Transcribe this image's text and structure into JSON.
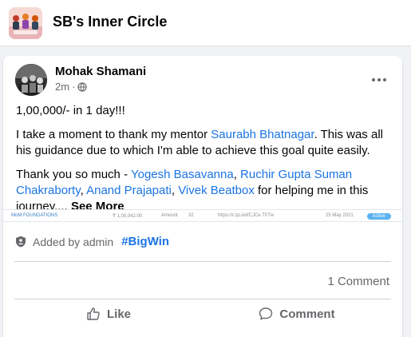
{
  "group": {
    "name": "SB's Inner Circle"
  },
  "post": {
    "author": "Mohak Shamani",
    "time": "2m",
    "separator": "·",
    "audience_icon": "globe-icon",
    "line1": "1,00,000/- in 1 day!!!",
    "line2_before": "I take a moment to thank my mentor ",
    "line2_mention": "Saurabh Bhatnagar",
    "line2_after": ". This was all his guidance due to which I'm able to achieve this goal quite easily.",
    "thanks_before": "Thank you so much - ",
    "mentions": [
      "Yogesh Basavanna",
      "Ruchir Gupta",
      "Suman Chakraborty",
      "Anand Prajapati",
      "Vivek Beatbox"
    ],
    "sep_comma": ", ",
    "sep_space": " ",
    "thanks_after": " for helping me in this journey....",
    "see_more": "See More"
  },
  "preview": {
    "org": "MoM FOUNDATIONS",
    "amount": "₹ 1,00,042.00",
    "amount_label": "Amount",
    "qty": "32",
    "link": "https://r.zp.io/l/CJCe T0Tw",
    "date": "25 May 2021",
    "status": "Active"
  },
  "added_by": {
    "icon": "admin-shield-icon",
    "text": "Added by admin",
    "hashtag": "#BigWin"
  },
  "comments": {
    "count_label": "1 Comment"
  },
  "actions": {
    "like": "Like",
    "comment": "Comment"
  },
  "colors": {
    "link": "#1b74e4",
    "muted": "#65676b",
    "background": "#f0f2f5"
  }
}
